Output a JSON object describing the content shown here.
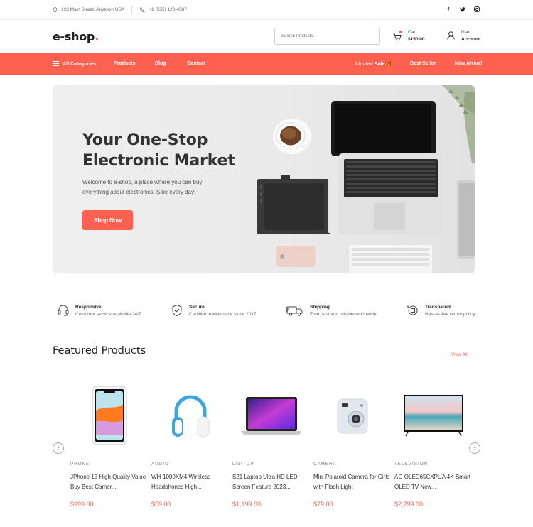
{
  "topbar": {
    "address": "123 Main Street, Anytown USA",
    "phone": "+1 (555) 123-4567",
    "social_icons": [
      "facebook-icon",
      "twitter-icon",
      "instagram-icon"
    ]
  },
  "header": {
    "logo": "e-shop",
    "logo_dot": ".",
    "search_placeholder": "Search Products...",
    "cart_label": "Cart",
    "cart_total": "$150,00",
    "user_label": "User",
    "account_label": "Account"
  },
  "nav": {
    "all_categories": "All Categories",
    "products": "Products",
    "blog": "Blog",
    "contact": "Contact",
    "limited_sale": "Limited Sale 🎁",
    "best_seller": "Best Seller",
    "new_arrival": "New Arrival"
  },
  "hero": {
    "title": "Your One-Stop Electronic Market",
    "subtitle": "Welcome to e-shop, a place where you can buy everything about electronics. Sale every day!",
    "button": "Shop Now"
  },
  "features": [
    {
      "title": "Responsive",
      "desc": "Customer service available 24/7",
      "icon": "headset-icon"
    },
    {
      "title": "Secure",
      "desc": "Certified marketplace since 2017",
      "icon": "shield-icon"
    },
    {
      "title": "Shipping",
      "desc": "Free, fast and reliable worldwide",
      "icon": "truck-icon"
    },
    {
      "title": "Transparent",
      "desc": "Hassle-free return policy",
      "icon": "return-icon"
    }
  ],
  "featured": {
    "title": "Featured Products",
    "view_all": "View All",
    "products": [
      {
        "category": "PHONE",
        "name": "JPhone 13 High Quality Value Buy Best Camer...",
        "price": "$999.00"
      },
      {
        "category": "AUDIO",
        "name": "WH-1000XM4 Wireless Headphones High...",
        "price": "$59.00"
      },
      {
        "category": "LAPTOP",
        "name": "S21 Laptop Ultra HD LED Screen Feature 2023...",
        "price": "$1,199.00"
      },
      {
        "category": "CAMERA",
        "name": "Mini Polaroid Camera for Girls with Flash Light",
        "price": "$79.00"
      },
      {
        "category": "TELEVISION",
        "name": "AG OLED65CXPUA 4K Smart OLED TV New...",
        "price": "$2,799.00"
      }
    ]
  },
  "colors": {
    "accent": "#ff6150"
  }
}
